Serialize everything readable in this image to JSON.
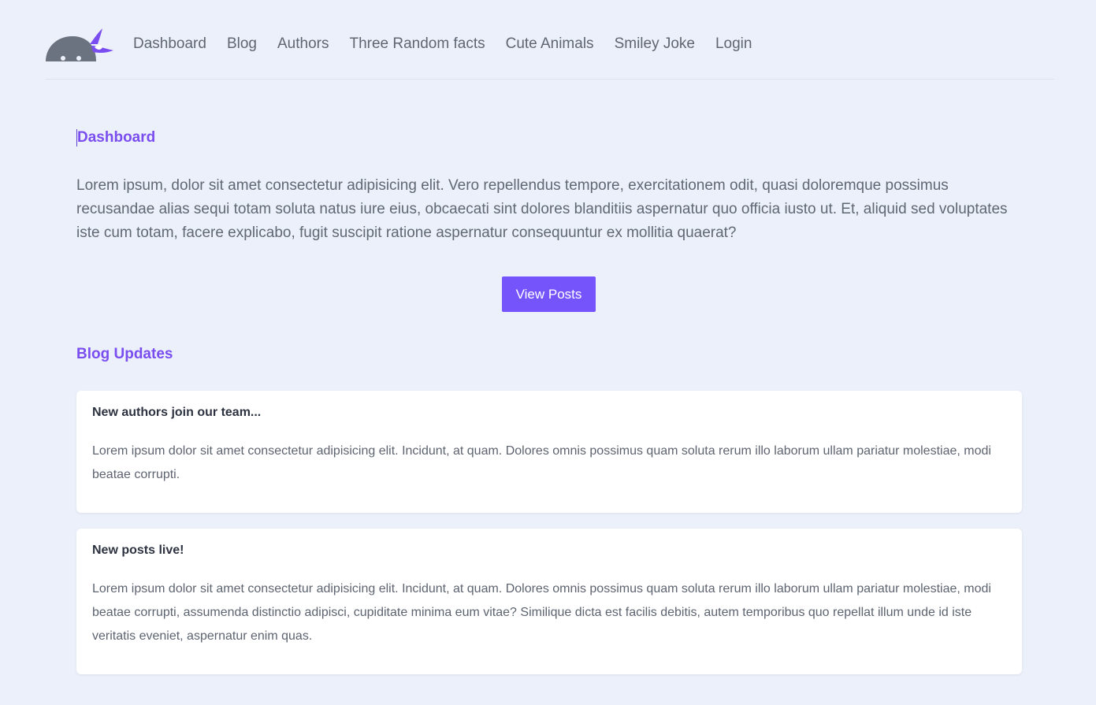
{
  "header": {
    "logo_icon": "ninja-logo-icon",
    "nav": [
      {
        "label": "Dashboard"
      },
      {
        "label": "Blog"
      },
      {
        "label": "Authors"
      },
      {
        "label": "Three Random facts"
      },
      {
        "label": "Cute Animals"
      },
      {
        "label": "Smiley Joke"
      },
      {
        "label": "Login"
      }
    ]
  },
  "main": {
    "title": "Dashboard",
    "intro": "Lorem ipsum, dolor sit amet consectetur adipisicing elit. Vero repellendus tempore, exercitationem odit, quasi doloremque possimus recusandae alias sequi totam soluta natus iure eius, obcaecati sint dolores blanditiis aspernatur quo officia iusto ut. Et, aliquid sed voluptates iste cum totam, facere explicabo, fugit suscipit ratione aspernatur consequuntur ex mollitia quaerat?",
    "button_label": "View Posts",
    "blog_updates_title": "Blog Updates",
    "updates": [
      {
        "title": "New authors join our team...",
        "body": "Lorem ipsum dolor sit amet consectetur adipisicing elit. Incidunt, at quam. Dolores omnis possimus quam soluta rerum illo laborum ullam pariatur molestiae, modi beatae corrupti."
      },
      {
        "title": "New posts live!",
        "body": "Lorem ipsum dolor sit amet consectetur adipisicing elit. Incidunt, at quam. Dolores omnis possimus quam soluta rerum illo laborum ullam pariatur molestiae, modi beatae corrupti, assumenda distinctio adipisci, cupiditate minima eum vitae? Similique dicta est facilis debitis, autem temporibus quo repellat illum unde id iste veritatis eveniet, aspernatur enim quas."
      }
    ]
  },
  "colors": {
    "background": "#ecf0fa",
    "accent": "#7555fb",
    "heading": "#7a4df0",
    "logo_gray": "#6b7280"
  }
}
